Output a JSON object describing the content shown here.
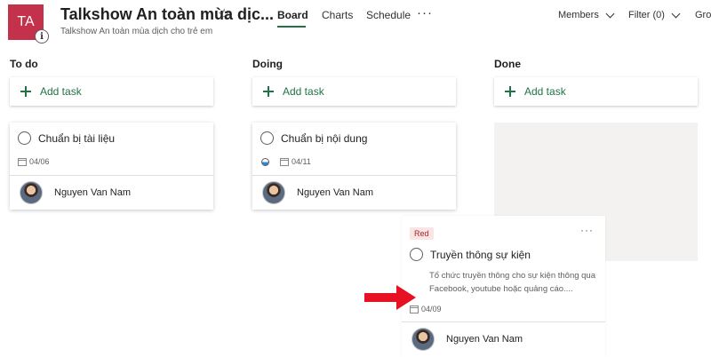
{
  "header": {
    "plan_initials": "TA",
    "info_glyph": "i",
    "plan_title": "Talkshow An toàn mùa dịc...",
    "plan_subtitle": "Talkshow An toàn mùa dịch cho trẻ em",
    "star_glyph": "☆",
    "tabs": [
      {
        "label": "Board",
        "active": true
      },
      {
        "label": "Charts",
        "active": false
      },
      {
        "label": "Schedule",
        "active": false
      }
    ],
    "more_glyph": "···",
    "members_label": "Members",
    "filter_label": "Filter (0)",
    "group_label": "Gro"
  },
  "columns": [
    {
      "title": "To do",
      "add_task": "Add task"
    },
    {
      "title": "Doing",
      "add_task": "Add task"
    },
    {
      "title": "Done",
      "add_task": "Add task"
    }
  ],
  "cards": [
    {
      "task": "Chuẩn bị tài liệu",
      "date": "04/06",
      "assignee": "Nguyen Van Nam"
    },
    {
      "task": "Chuẩn bị nội dung",
      "date": "04/11",
      "assignee": "Nguyen Van Nam",
      "progress": "in progress"
    }
  ],
  "dragged_card": {
    "label": "Red",
    "label_color": "#a4262c",
    "more_glyph": "···",
    "task": "Truyền thông sự kiện",
    "description": "Tổ chức truyền thông cho sự kiện thông qua Facebook, youtube hoặc quảng cáo....",
    "date": "04/09",
    "assignee": "Nguyen Van Nam"
  },
  "colors": {
    "accent_green": "#217346",
    "plan_avatar": "#c4314b",
    "arrow_red": "#e81123"
  },
  "icons": [
    "info-icon",
    "star-icon",
    "more-icon",
    "chevron-down-icon",
    "plus-icon",
    "circle-checkbox-icon",
    "calendar-icon",
    "progress-icon",
    "avatar",
    "red-arrow-icon"
  ]
}
